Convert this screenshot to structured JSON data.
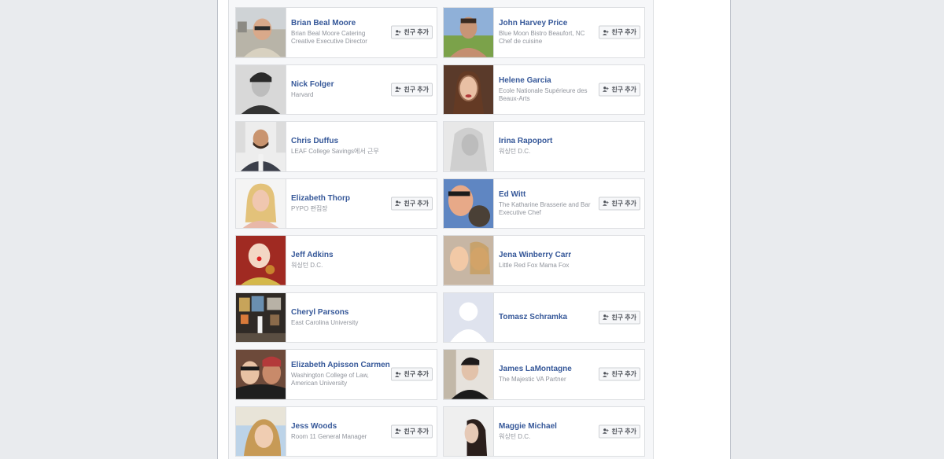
{
  "add_friend_label": "친구 추가",
  "cards": [
    {
      "name": "Brian Beal Moore",
      "line1": "Brian Beal Moore Catering",
      "line2": "Creative Executive Director",
      "button": true,
      "photo": "man-glasses-city"
    },
    {
      "name": "John Harvey Price",
      "line1": "Blue Moon Bistro Beaufort, NC",
      "line2": "Chef de cuisine",
      "button": true,
      "photo": "man-field"
    },
    {
      "name": "Nick Folger",
      "line1": "Harvard",
      "line2": "",
      "button": true,
      "photo": "man-bw"
    },
    {
      "name": "Helene Garcia",
      "line1": "Ecole Nationale Supérieure des",
      "line2": "Beaux-Arts",
      "button": true,
      "photo": "woman-brown-hair"
    },
    {
      "name": "Chris Duffus",
      "line1": "LEAF College Savings에서 근무",
      "line2": "",
      "button": false,
      "photo": "man-beard-suit"
    },
    {
      "name": "Irina Rapoport",
      "line1": "워싱턴 D.C.",
      "line2": "",
      "button": false,
      "photo": "woman-bw-blonde"
    },
    {
      "name": "Elizabeth Thorp",
      "line1": "PYPO 편집장",
      "line2": "",
      "button": true,
      "photo": "woman-blonde"
    },
    {
      "name": "Ed Witt",
      "line1": "The Katharine Brasserie and Bar",
      "line2": "Executive Chef",
      "button": true,
      "photo": "man-sunglasses-dog"
    },
    {
      "name": "Jeff Adkins",
      "line1": "워싱턴 D.C.",
      "line2": "",
      "button": false,
      "photo": "clown-red"
    },
    {
      "name": "Jena Winberry Carr",
      "line1": "Little Red Fox Mama Fox",
      "line2": "",
      "button": false,
      "photo": "mother-child"
    },
    {
      "name": "Cheryl Parsons",
      "line1": "East Carolina University",
      "line2": "",
      "button": false,
      "photo": "gallery"
    },
    {
      "name": "Tomasz Schramka",
      "line1": "",
      "line2": "",
      "button": true,
      "photo": "default-silhouette"
    },
    {
      "name": "Elizabeth Apisson Carmen",
      "line1": "Washington College of Law,",
      "line2": "American University",
      "button": true,
      "photo": "costume-pair"
    },
    {
      "name": "James LaMontagne",
      "line1": "The Majestic VA Partner",
      "line2": "",
      "button": true,
      "photo": "man-dark-hair"
    },
    {
      "name": "Jess Woods",
      "line1": "Room 11 General Manager",
      "line2": "",
      "button": true,
      "photo": "woman-selfie-car"
    },
    {
      "name": "Maggie Michael",
      "line1": "워싱턴 D.C.",
      "line2": "",
      "button": true,
      "photo": "woman-profile"
    }
  ],
  "colors": {
    "page_bg": "#e9ebee",
    "link": "#365899",
    "subtext": "#90949c",
    "border": "#dddfe2"
  }
}
